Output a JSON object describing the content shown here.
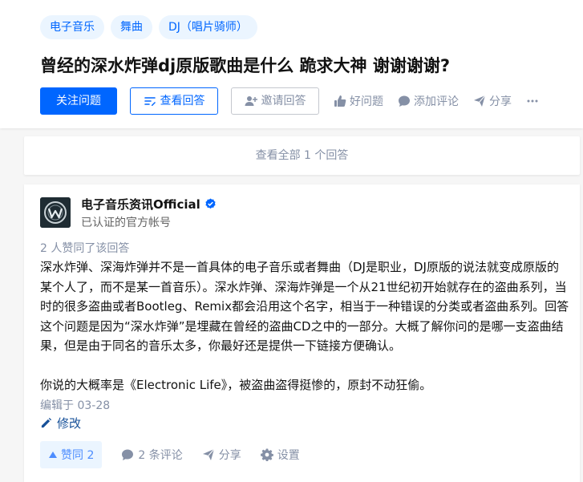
{
  "question": {
    "tags": [
      "电子音乐",
      "舞曲",
      "DJ（唱片骑师）"
    ],
    "title": "曾经的深水炸弹dj原版歌曲是什么 跪求大神 谢谢谢谢?",
    "follow_label": "关注问题",
    "view_answers_label": "查看回答",
    "invite_label": "邀请回答",
    "like_label": "好问题",
    "comment_label": "添加评论",
    "share_label": "分享"
  },
  "view_all": "查看全部 1 个回答",
  "answer": {
    "author_name": "电子音乐资讯Official",
    "author_desc": "已认证的官方帐号",
    "voters": "2 人赞同了该回答",
    "paragraphs": [
      "深水炸弹、深海炸弹并不是一首具体的电子音乐或者舞曲（DJ是职业，DJ原版的说法就变成原版的某个人了，而不是某一首音乐）。深水炸弹、深海炸弹是一个从21世纪初开始就存在的盗曲系列，当时的很多盗曲或者Bootleg、Remix都会沿用这个名字，相当于一种错误的分类或者盗曲系列。回答这个问题是因为“深水炸弹”是埋藏在曾经的盗曲CD之中的一部分。大概了解你问的是哪一支盗曲结果，但是由于同名的音乐太多，你最好还是提供一下链接方便确认。",
      "你说的大概率是《Electronic Life》，被盗曲盗得挺惨的，原封不动狂偷。"
    ],
    "edited": "编辑于 03-28",
    "modify_label": "修改",
    "vote_label": "赞同 2",
    "comments_label": "2 条评论",
    "share_label": "分享",
    "settings_label": "设置"
  },
  "colors": {
    "brand": "#0066ff",
    "tag_bg": "#ebf5ff",
    "muted": "#8590a6",
    "link": "#175199"
  }
}
